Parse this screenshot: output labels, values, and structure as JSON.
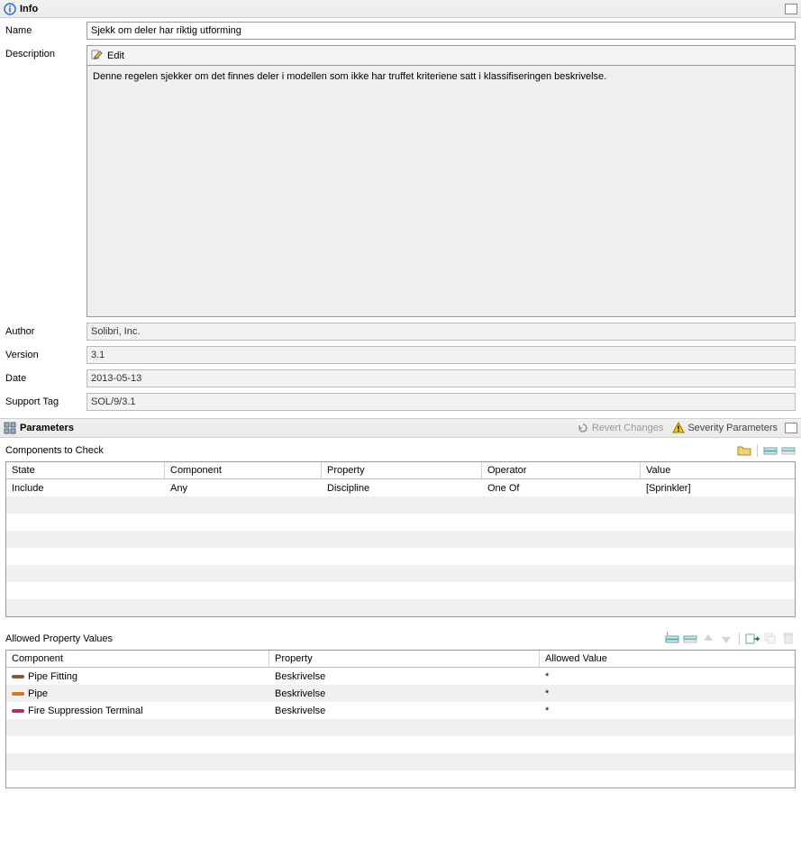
{
  "info": {
    "panel_title": "Info",
    "labels": {
      "name": "Name",
      "description": "Description",
      "author": "Author",
      "version": "Version",
      "date": "Date",
      "support_tag": "Support Tag"
    },
    "edit_button": "Edit",
    "name": "Sjekk om deler har riktig utforming",
    "description": "Denne regelen sjekker om det finnes deler i modellen som ikke har truffet kriteriene satt i klassifiseringen beskrivelse.",
    "author": "Solibri, Inc.",
    "version": "3.1",
    "date": "2013-05-13",
    "support_tag": "SOL/9/3.1"
  },
  "parameters": {
    "panel_title": "Parameters",
    "revert_label": "Revert Changes",
    "severity_label": "Severity Parameters"
  },
  "components_to_check": {
    "title": "Components to Check",
    "headers": {
      "state": "State",
      "component": "Component",
      "property": "Property",
      "operator": "Operator",
      "value": "Value"
    },
    "rows": [
      {
        "state": "Include",
        "component": "Any",
        "property": "Discipline",
        "operator": "One Of",
        "value": "[Sprinkler]"
      }
    ]
  },
  "allowed_property_values": {
    "title": "Allowed Property Values",
    "headers": {
      "component": "Component",
      "property": "Property",
      "allowed_value": "Allowed Value"
    },
    "rows": [
      {
        "component": "Pipe Fitting",
        "property": "Beskrivelse",
        "allowed_value": "*",
        "color": "#8a5a2b"
      },
      {
        "component": "Pipe",
        "property": "Beskrivelse",
        "allowed_value": "*",
        "color": "#c97a36"
      },
      {
        "component": "Fire Suppression Terminal",
        "property": "Beskrivelse",
        "allowed_value": "*",
        "color": "#b03060"
      }
    ]
  }
}
